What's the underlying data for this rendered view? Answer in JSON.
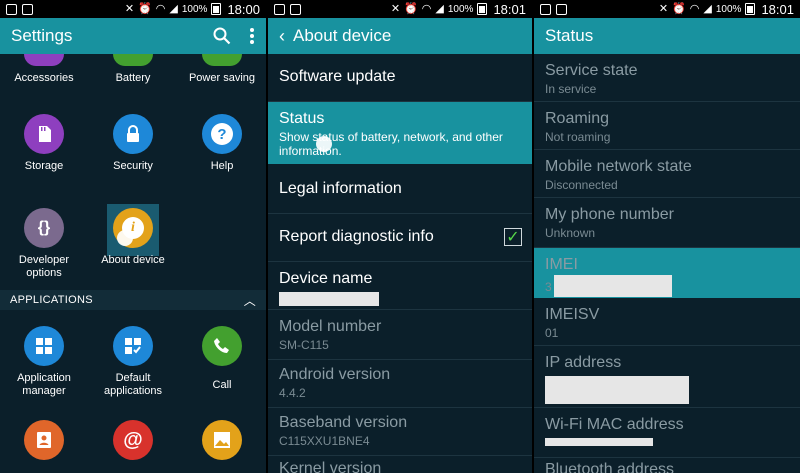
{
  "statusbar": {
    "battery_pct": "100%",
    "panel1_time": "18:00",
    "panel2_time": "18:01",
    "panel3_time": "18:01"
  },
  "settings": {
    "title": "Settings",
    "top_row": [
      "Accessories",
      "Battery",
      "Power saving"
    ],
    "items": [
      {
        "label": "Storage",
        "icon": "sd-card-icon",
        "color": "#8e3fbf"
      },
      {
        "label": "Security",
        "icon": "lock-icon",
        "color": "#1e88d8"
      },
      {
        "label": "Help",
        "icon": "help-icon",
        "color": "#1e88d8"
      },
      {
        "label": "Developer options",
        "icon": "braces-icon",
        "color": "#7b6a8e"
      },
      {
        "label": "About device",
        "icon": "info-icon",
        "color": "#e3a21a"
      }
    ],
    "section_label": "APPLICATIONS",
    "apps": [
      {
        "label": "Application manager",
        "icon": "grid-icon",
        "color": "#1e88d8"
      },
      {
        "label": "Default applications",
        "icon": "default-apps-icon",
        "color": "#1e88d8"
      },
      {
        "label": "Call",
        "icon": "phone-icon",
        "color": "#43a02f"
      }
    ],
    "bottom_row_colors": [
      "#e0662a",
      "#d8322c",
      "#e3a21a"
    ]
  },
  "about": {
    "title": "About device",
    "items": [
      {
        "title": "Software update",
        "sub": ""
      },
      {
        "title": "Status",
        "sub": "Show status of battery, network, and other information."
      },
      {
        "title": "Legal information",
        "sub": ""
      },
      {
        "title": "Report diagnostic info",
        "sub": "",
        "checked": true
      },
      {
        "title": "Device name",
        "sub": ""
      },
      {
        "title": "Model number",
        "sub": "SM-C115"
      },
      {
        "title": "Android version",
        "sub": "4.4.2"
      },
      {
        "title": "Baseband version",
        "sub": "C115XXU1BNE4"
      },
      {
        "title": "Kernel version",
        "sub": ""
      }
    ]
  },
  "status": {
    "title": "Status",
    "items": [
      {
        "title": "Service state",
        "sub": "In service"
      },
      {
        "title": "Roaming",
        "sub": "Not roaming"
      },
      {
        "title": "Mobile network state",
        "sub": "Disconnected"
      },
      {
        "title": "My phone number",
        "sub": "Unknown"
      },
      {
        "title": "IMEI",
        "sub": "3"
      },
      {
        "title": "IMEISV",
        "sub": "01"
      },
      {
        "title": "IP address",
        "sub": ""
      },
      {
        "title": "Wi-Fi MAC address",
        "sub": ""
      },
      {
        "title": "Bluetooth address",
        "sub": ""
      }
    ]
  },
  "colors": {
    "accent": "#18929f",
    "background": "#0b1f2a",
    "checkmark": "#56d64a"
  }
}
